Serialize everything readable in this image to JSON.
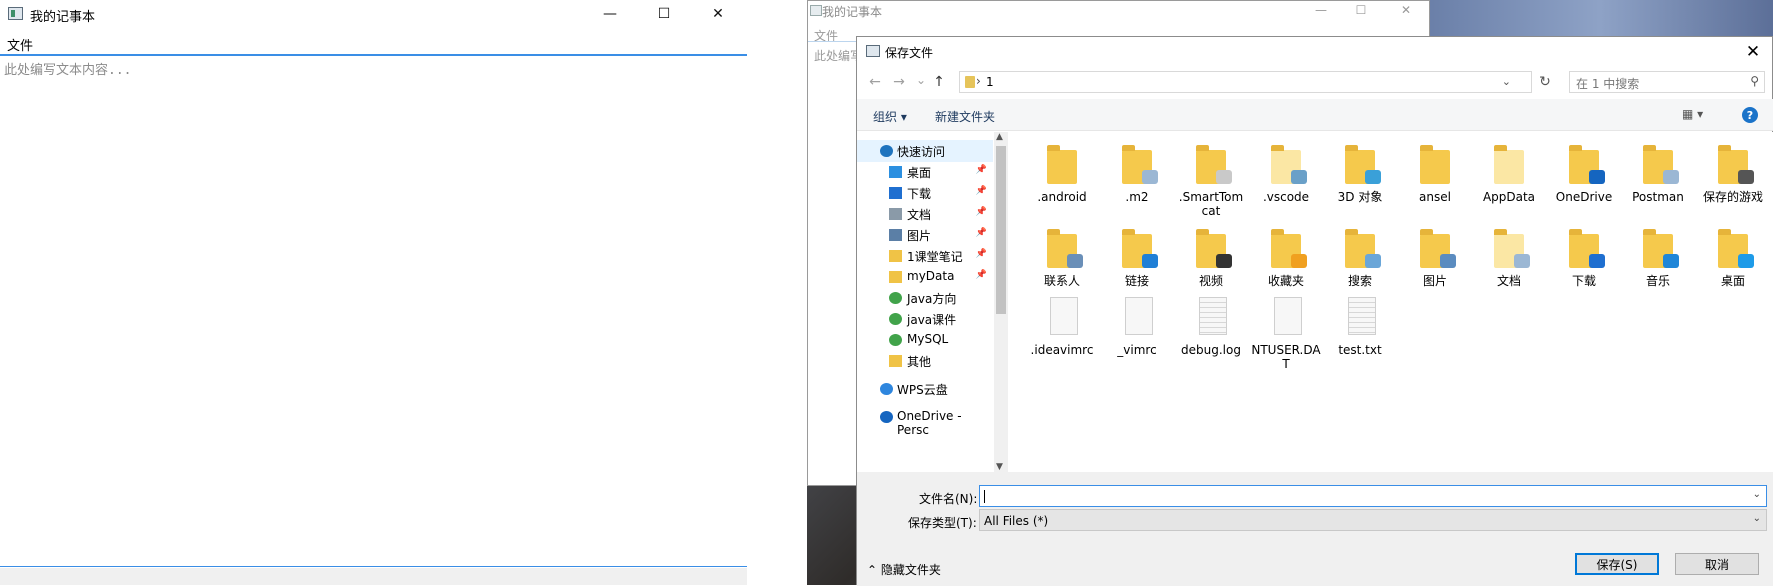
{
  "notepad": {
    "title": "我的记事本",
    "menu_file": "文件",
    "placeholder": "此处编写文本内容...",
    "min": "—",
    "max": "☐",
    "close": "✕"
  },
  "back_window": {
    "title": "我的记事本",
    "menu_file": "文件",
    "placeholder_partial": "此处编写"
  },
  "dialog": {
    "title": "保存文件",
    "close": "✕",
    "nav_back": "←",
    "nav_forward": "→",
    "nav_recent": "⌄",
    "nav_up": "↑",
    "address_crumb": "1",
    "address_sep": "›",
    "search_placeholder": "在 1 中搜索",
    "organize": "组织 ▾",
    "new_folder": "新建文件夹",
    "view": "▦ ▾",
    "help": "?",
    "nav_items": [
      {
        "label": "快速访问",
        "icon": "star-icon",
        "color": "#1e73be",
        "pin": ""
      },
      {
        "label": "桌面",
        "icon": "desktop-icon",
        "color": "#2b8fe0",
        "pin": "📌"
      },
      {
        "label": "下载",
        "icon": "download-icon",
        "color": "#1f6fd0",
        "pin": "📌"
      },
      {
        "label": "文档",
        "icon": "document-icon",
        "color": "#8a9aa8",
        "pin": "📌"
      },
      {
        "label": "图片",
        "icon": "picture-icon",
        "color": "#5b7fa6",
        "pin": "📌"
      },
      {
        "label": "1课堂笔记",
        "icon": "folder-icon",
        "color": "#f0c346",
        "pin": "📌"
      },
      {
        "label": "myData",
        "icon": "folder-icon",
        "color": "#f0c346",
        "pin": "📌"
      },
      {
        "label": "Java方向",
        "icon": "sync-folder-icon",
        "color": "#41a34a",
        "pin": ""
      },
      {
        "label": "java课件",
        "icon": "sync-folder-icon",
        "color": "#41a34a",
        "pin": ""
      },
      {
        "label": "MySQL",
        "icon": "sync-folder-icon",
        "color": "#41a34a",
        "pin": ""
      },
      {
        "label": "其他",
        "icon": "folder-icon",
        "color": "#f0c346",
        "pin": ""
      },
      {
        "label": "WPS云盘",
        "icon": "cloud-icon",
        "color": "#2e86de",
        "pin": ""
      },
      {
        "label": "OneDrive - Persc",
        "icon": "onedrive-icon",
        "color": "#1565c0",
        "pin": ""
      }
    ],
    "files": [
      {
        "name": ".android",
        "kind": "folder",
        "badge": ""
      },
      {
        "name": ".m2",
        "kind": "folder",
        "badge": "#9bb7d4"
      },
      {
        "name": ".SmartTomcat",
        "kind": "folder",
        "badge": "#c9c9c9"
      },
      {
        "name": ".vscode",
        "kind": "folder-light",
        "badge": "#6aa0c8"
      },
      {
        "name": "3D 对象",
        "kind": "folder",
        "badge": "#3aa0d8"
      },
      {
        "name": "ansel",
        "kind": "folder",
        "badge": ""
      },
      {
        "name": "AppData",
        "kind": "folder-light",
        "badge": ""
      },
      {
        "name": "OneDrive",
        "kind": "folder",
        "badge": "#1565c0"
      },
      {
        "name": "Postman",
        "kind": "folder",
        "badge": "#9bb7d4"
      },
      {
        "name": "保存的游戏",
        "kind": "folder",
        "badge": "#555555"
      },
      {
        "name": "联系人",
        "kind": "folder",
        "badge": "#6a8fb8"
      },
      {
        "name": "链接",
        "kind": "folder",
        "badge": "#1f7fd6"
      },
      {
        "name": "视频",
        "kind": "folder",
        "badge": "#333333"
      },
      {
        "name": "收藏夹",
        "kind": "folder",
        "badge": "#f0a020"
      },
      {
        "name": "搜索",
        "kind": "folder",
        "badge": "#6aa6d8"
      },
      {
        "name": "图片",
        "kind": "folder",
        "badge": "#5b8cc0"
      },
      {
        "name": "文档",
        "kind": "folder-light",
        "badge": "#9bb7d4"
      },
      {
        "name": "下载",
        "kind": "folder",
        "badge": "#1f6fd0"
      },
      {
        "name": "音乐",
        "kind": "folder",
        "badge": "#1f86d8"
      },
      {
        "name": "桌面",
        "kind": "folder",
        "badge": "#1e9be8"
      },
      {
        "name": ".ideavimrc",
        "kind": "file",
        "badge": ""
      },
      {
        "name": "_vimrc",
        "kind": "file",
        "badge": ""
      },
      {
        "name": "debug.log",
        "kind": "file-lined",
        "badge": ""
      },
      {
        "name": "NTUSER.DAT",
        "kind": "file",
        "badge": ""
      },
      {
        "name": "test.txt",
        "kind": "file-lined",
        "badge": ""
      }
    ],
    "filename_label": "文件名(N):",
    "filename_value": "",
    "filetype_label": "保存类型(T):",
    "filetype_value": "All Files  (*)",
    "hide_folders": "⌃ 隐藏文件夹",
    "save": "保存(S)",
    "cancel": "取消"
  }
}
